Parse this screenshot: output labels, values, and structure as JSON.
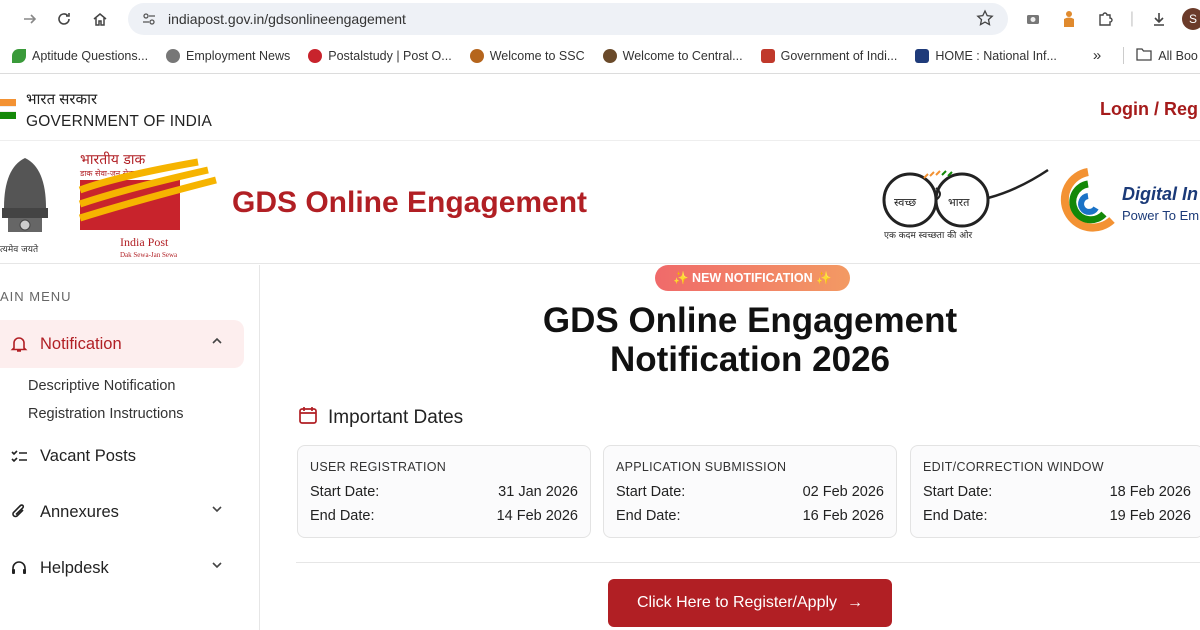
{
  "browser": {
    "url": "indiapost.gov.in/gdsonlineengagement",
    "profile_initial": "S",
    "bookmarks": [
      {
        "label": "Aptitude Questions..."
      },
      {
        "label": "Employment News"
      },
      {
        "label": "Postalstudy | Post O..."
      },
      {
        "label": "Welcome to SSC"
      },
      {
        "label": "Welcome to Central..."
      },
      {
        "label": "Government of Indi..."
      },
      {
        "label": "HOME : National Inf..."
      }
    ],
    "more_bookmarks": "»",
    "all_bookmarks": "All Boo"
  },
  "gov": {
    "hindi": "भारत सरकार",
    "english": "GOVERNMENT OF INDIA",
    "login": "Login / Reg"
  },
  "brand": {
    "emblem_motto": "त्यमेव जयते",
    "india_post_hi": "भारतीय डाक",
    "india_post_tag_hi": "डाक सेवा-जन सेवा",
    "india_post_en": "India Post",
    "india_post_tag_en": "Dak Sewa-Jan Sewa",
    "title": "GDS Online Engagement",
    "swachh_left": "स्वच्छ",
    "swachh_right": "भारत",
    "swachh_tag": "एक कदम स्वच्छता की ओर",
    "digital_title": "Digital In",
    "digital_sub": "Power To Emp"
  },
  "sidebar": {
    "menu_heading": "AIN MENU",
    "items": [
      {
        "label": "Notification",
        "icon": "bell-icon"
      },
      {
        "label": "Vacant Posts",
        "icon": "list-check-icon"
      },
      {
        "label": "Annexures",
        "icon": "paperclip-icon"
      },
      {
        "label": "Helpdesk",
        "icon": "headset-icon"
      }
    ],
    "sub_items": [
      {
        "label": "Descriptive Notification"
      },
      {
        "label": "Registration Instructions"
      }
    ]
  },
  "main": {
    "badge": "✨ NEW NOTIFICATION ✨",
    "title_line1": "GDS Online Engagement",
    "title_line2": "Notification 2026",
    "dates_heading": "Important Dates",
    "start_label": "Start Date:",
    "end_label": "End Date:",
    "cards": [
      {
        "title": "USER REGISTRATION",
        "start": "31 Jan 2026",
        "end": "14 Feb 2026"
      },
      {
        "title": "APPLICATION SUBMISSION",
        "start": "02 Feb 2026",
        "end": "16 Feb 2026"
      },
      {
        "title": "EDIT/CORRECTION WINDOW",
        "start": "18 Feb 2026",
        "end": "19 Feb 2026"
      }
    ],
    "cta": "Click Here to Register/Apply",
    "cta_arrow": "→"
  },
  "colors": {
    "brand_red": "#b11f24",
    "digital_blue": "#1b3a78"
  }
}
